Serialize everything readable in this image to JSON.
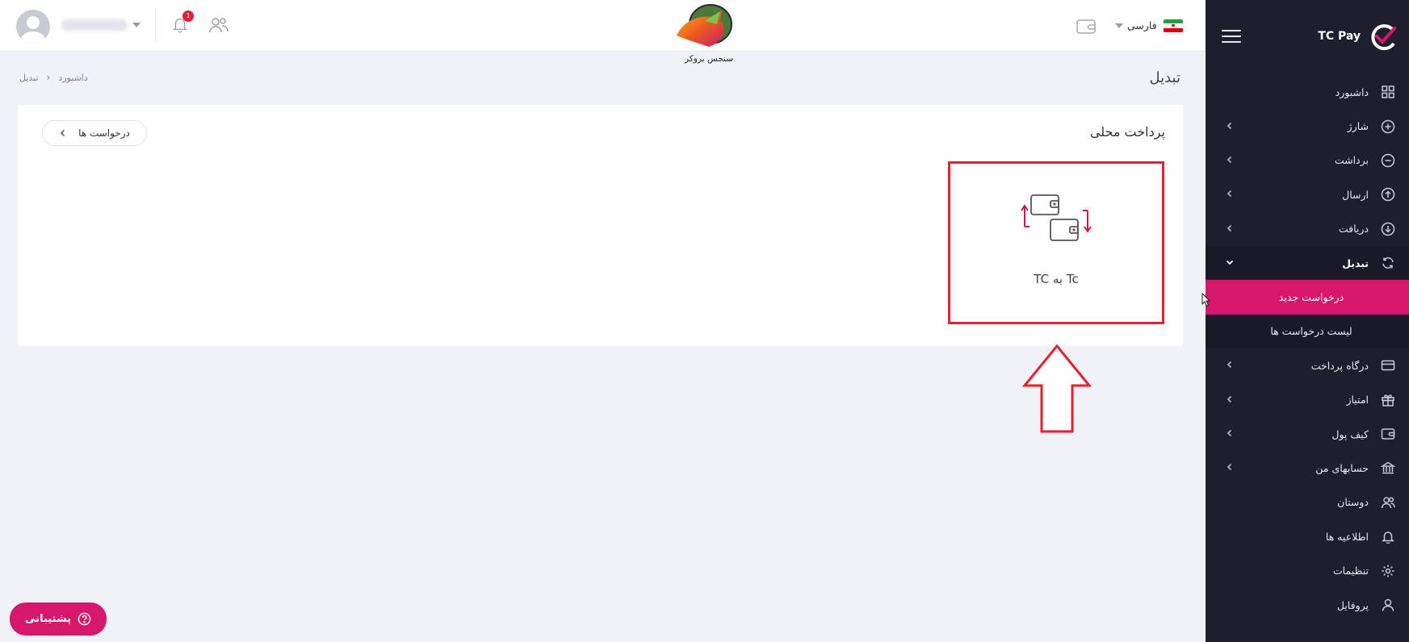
{
  "brand": {
    "name": "TC Pay"
  },
  "header": {
    "logo_text": "سنجس بروکر",
    "language": "فارسی",
    "notification_count": "1"
  },
  "page": {
    "title": "تبدیل",
    "breadcrumb": [
      "داشبورد",
      "تبدیل"
    ]
  },
  "card": {
    "title": "پرداخت محلی",
    "requests_button": "درخواست ها",
    "tile_label": "Tc به TC"
  },
  "sidebar": {
    "items": [
      {
        "label": "داشبورد",
        "icon": "dashboard-icon"
      },
      {
        "label": "شارژ",
        "icon": "plus-circle-icon"
      },
      {
        "label": "برداشت",
        "icon": "minus-circle-icon"
      },
      {
        "label": "ارسال",
        "icon": "arrow-up-circle-icon"
      },
      {
        "label": "دریافت",
        "icon": "arrow-down-circle-icon"
      },
      {
        "label": "تبدیل",
        "icon": "refresh-icon"
      },
      {
        "label": "درگاه پرداخت",
        "icon": "card-icon"
      },
      {
        "label": "امتیاز",
        "icon": "gift-icon"
      },
      {
        "label": "کیف پول",
        "icon": "wallet-icon"
      },
      {
        "label": "حسابهای من",
        "icon": "bank-icon"
      },
      {
        "label": "دوستان",
        "icon": "users-icon"
      },
      {
        "label": "اطلاعیه ها",
        "icon": "bell-icon"
      },
      {
        "label": "تنظیمات",
        "icon": "gear-icon"
      },
      {
        "label": "پروفایل",
        "icon": "user-icon"
      }
    ],
    "submenu": [
      {
        "label": "درخواست جدید"
      },
      {
        "label": "لیست درخواست ها"
      }
    ]
  },
  "support": {
    "label": "پشتیبانی"
  },
  "colors": {
    "accent": "#d6176b",
    "sidebar_bg": "#1e1f2e",
    "highlight": "#e2222f"
  }
}
